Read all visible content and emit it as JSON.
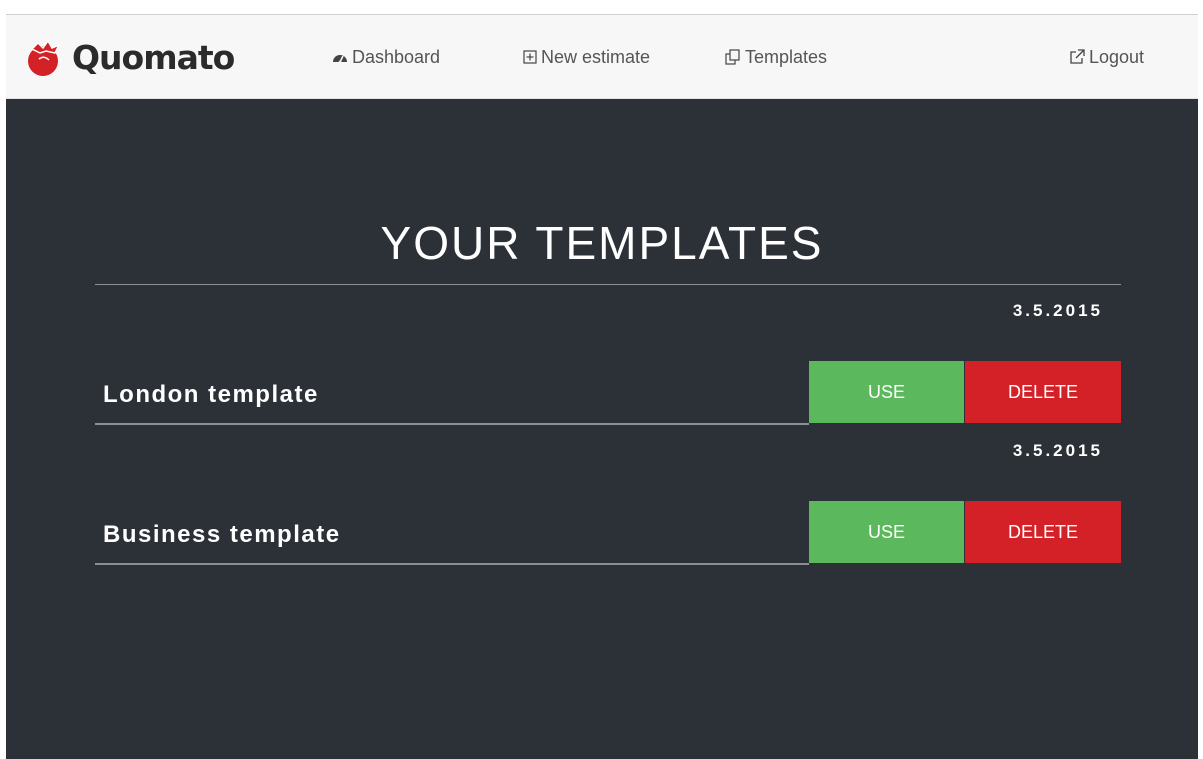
{
  "colors": {
    "background": "#2c3137",
    "navbar": "#f7f7f7",
    "brand": "#d42127",
    "use_button": "#5cb85c",
    "delete_button": "#d42127",
    "text_light": "#ffffff",
    "nav_text": "#555555"
  },
  "brand": {
    "name": "Quomato",
    "logo_icon": "tomato-icon"
  },
  "nav": {
    "dashboard": {
      "label": "Dashboard",
      "icon": "dashboard-icon"
    },
    "new_estimate": {
      "label": "New estimate",
      "icon": "plus-square-icon"
    },
    "templates": {
      "label": "Templates",
      "icon": "copy-icon"
    },
    "logout": {
      "label": "Logout",
      "icon": "external-link-icon"
    }
  },
  "page_title": "YOUR TEMPLATES",
  "templates": [
    {
      "date": "3.5.2015",
      "name": "London template",
      "use_label": "USE",
      "delete_label": "DELETE"
    },
    {
      "date": "3.5.2015",
      "name": "Business template",
      "use_label": "USE",
      "delete_label": "DELETE"
    }
  ]
}
